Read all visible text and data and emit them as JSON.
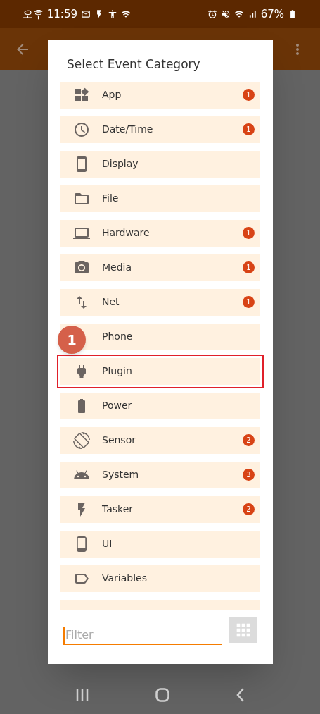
{
  "status_bar": {
    "time": "오후 11:59",
    "battery": "67%"
  },
  "dialog": {
    "title": "Select Event Category",
    "items": [
      {
        "label": "App",
        "badge": "1",
        "highlighted": false
      },
      {
        "label": "Date/Time",
        "badge": "1",
        "highlighted": false
      },
      {
        "label": "Display",
        "highlighted": false
      },
      {
        "label": "File",
        "highlighted": false
      },
      {
        "label": "Hardware",
        "badge": "1",
        "highlighted": false
      },
      {
        "label": "Media",
        "badge": "1",
        "highlighted": false
      },
      {
        "label": "Net",
        "badge": "1",
        "highlighted": false
      },
      {
        "label": "Phone",
        "highlighted": false
      },
      {
        "label": "Plugin",
        "highlighted": true
      },
      {
        "label": "Power",
        "highlighted": false
      },
      {
        "label": "Sensor",
        "badge": "2",
        "highlighted": false
      },
      {
        "label": "System",
        "badge": "3",
        "highlighted": false
      },
      {
        "label": "Tasker",
        "badge": "2",
        "highlighted": false
      },
      {
        "label": "UI",
        "highlighted": false
      },
      {
        "label": "Variables",
        "highlighted": false
      },
      {
        "highlighted": false
      }
    ],
    "filter": {
      "placeholder": "Filter"
    }
  },
  "callout": {
    "label": "1"
  }
}
